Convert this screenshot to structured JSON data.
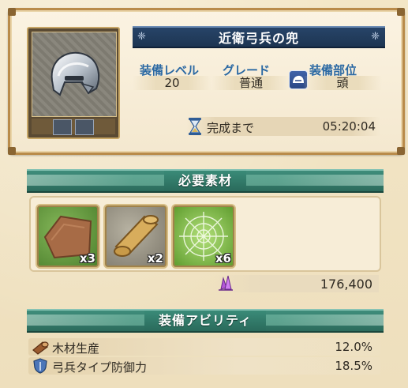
{
  "item": {
    "name": "近衛弓兵の兜",
    "icon": "helmet-icon",
    "stats": [
      {
        "label": "装備レベル",
        "value": "20"
      },
      {
        "label": "グレード",
        "value": "普通"
      },
      {
        "label": "装備部位",
        "value": "頭",
        "icon": "head-slot-icon"
      }
    ],
    "timer_label": "完成まで",
    "timer_value": "05:20:04"
  },
  "materials": {
    "title": "必要素材",
    "items": [
      {
        "name": "leather",
        "icon": "leather-icon",
        "count": "x3"
      },
      {
        "name": "scroll",
        "icon": "scroll-icon",
        "count": "x2"
      },
      {
        "name": "spider-web",
        "icon": "spider-web-icon",
        "count": "x6"
      }
    ],
    "cost_icon": "crystal-icon",
    "cost_value": "176,400"
  },
  "abilities": {
    "title": "装備アビリティ",
    "items": [
      {
        "name": "木材生産",
        "value": "12.0%",
        "icon": "log-icon"
      },
      {
        "name": "弓兵タイプ防御力",
        "value": "18.5%",
        "icon": "shield-icon"
      }
    ]
  },
  "colors": {
    "banner_navy": "#1d3552",
    "section_green": "#2c6b5c",
    "stat_label_blue": "#2b69a3",
    "parchment": "#efe0bf",
    "frame_gold": "#b98b4a"
  }
}
